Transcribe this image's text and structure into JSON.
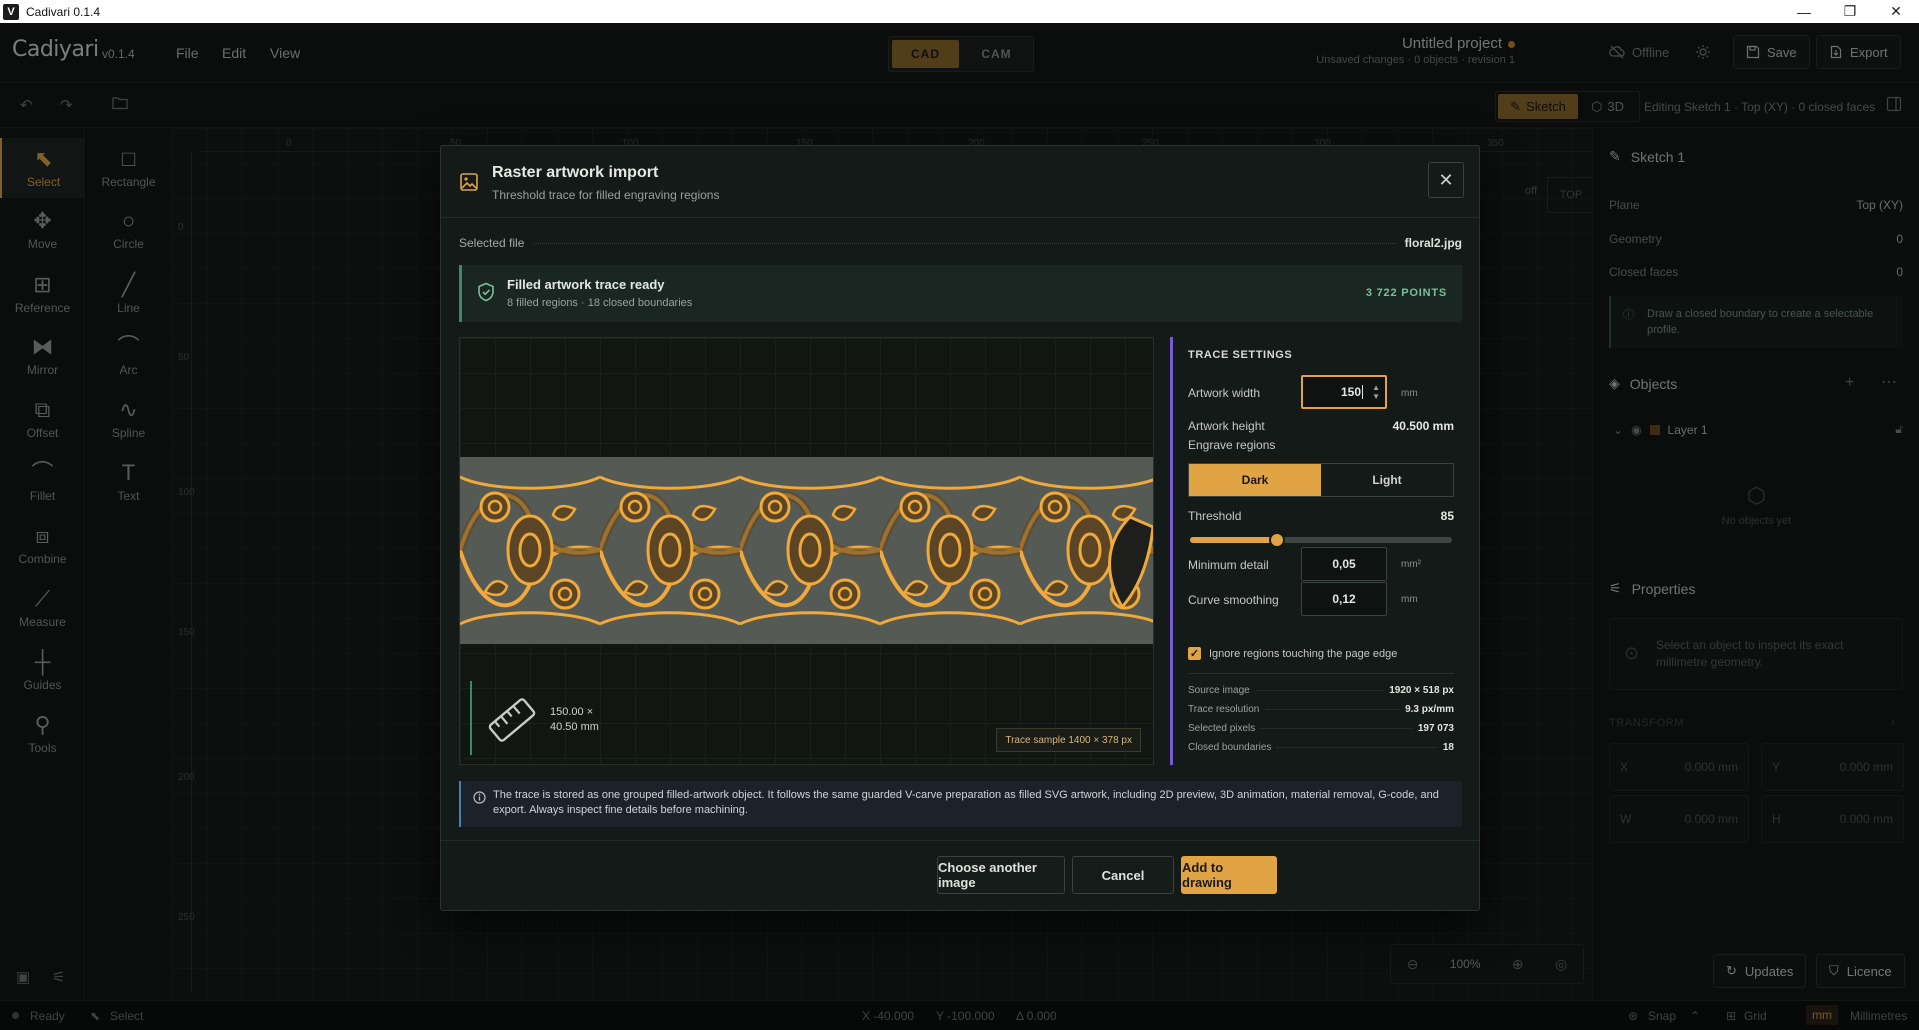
{
  "window": {
    "title": "Cadivari 0.1.4",
    "logo": "V",
    "controls": [
      "—",
      "❐",
      "✕"
    ]
  },
  "menubar": {
    "brand": "Cadiyari",
    "version": "v0.1.4",
    "menus": [
      "File",
      "Edit",
      "View"
    ],
    "modes": [
      "CAD",
      "CAM"
    ],
    "project_name": "Untitled project",
    "project_status": "Unsaved changes · 0 objects · revision 1",
    "offline_label": "Offline",
    "save_label": "Save",
    "export_label": "Export"
  },
  "toolrow": {
    "view_sketch": "Sketch",
    "view_3d": "3D",
    "editing_text": "Editing Sketch 1 · Top (XY) · 0 closed faces"
  },
  "tools_left": [
    "Select",
    "Move",
    "Reference",
    "Mirror",
    "Offset",
    "Fillet",
    "Combine",
    "Measure",
    "Guides",
    "Tools"
  ],
  "tools_right": [
    "Rectangle",
    "Circle",
    "Line",
    "Arc",
    "Spline",
    "Text"
  ],
  "rulers": {
    "x": [
      "0",
      "50",
      "100",
      "150",
      "200",
      "250",
      "300",
      "350"
    ],
    "y": [
      "0",
      "50",
      "100",
      "150",
      "200",
      "250"
    ]
  },
  "viewcube": {
    "label": "TOP",
    "off_label": "off"
  },
  "zoom": {
    "level": "100%"
  },
  "panel": {
    "sketch_title": "Sketch 1",
    "rows": [
      {
        "label": "Plane",
        "value": "Top (XY)"
      },
      {
        "label": "Geometry",
        "value": "0"
      },
      {
        "label": "Closed faces",
        "value": "0"
      }
    ],
    "sketch_note": "Draw a closed boundary to create a selectable profile.",
    "objects_title": "Objects",
    "layer_name": "Layer 1",
    "no_objects": "No objects yet",
    "properties_title": "Properties",
    "properties_note": "Select an object to inspect its exact millimetre geometry.",
    "transform_title": "TRANSFORM",
    "fields": [
      {
        "label": "X",
        "value": "0.000",
        "unit": "mm"
      },
      {
        "label": "Y",
        "value": "0.000",
        "unit": "mm"
      },
      {
        "label": "W",
        "value": "0.000",
        "unit": "mm"
      },
      {
        "label": "H",
        "value": "0.000",
        "unit": "mm"
      }
    ],
    "updates_label": "Updates",
    "licence_label": "Licence"
  },
  "statusbar": {
    "ready": "Ready",
    "tool": "Select",
    "x": "X  -40.000",
    "y": "Y  -100.000",
    "delta": "Δ  0.000",
    "snap": "Snap",
    "grid": "Grid",
    "unit": "mm",
    "unit_name": "Millimetres"
  },
  "modal": {
    "title": "Raster artwork import",
    "subtitle": "Threshold trace for filled engraving regions",
    "selected_file_label": "Selected file",
    "selected_file": "floral2.jpg",
    "banner_title": "Filled artwork trace ready",
    "banner_sub": "8 filled regions · 18 closed boundaries",
    "banner_points": "3 722 POINTS",
    "dims_text_1": "150.00 ×",
    "dims_text_2": "40.50 mm",
    "trace_sample": "Trace sample 1400 × 378 px",
    "settings": {
      "heading": "TRACE SETTINGS",
      "width_label": "Artwork width",
      "width_value": "150",
      "width_unit": "mm",
      "height_label": "Artwork height",
      "height_value": "40.500 mm",
      "engrave_label": "Engrave regions",
      "engrave_options": [
        "Dark",
        "Light"
      ],
      "engrave_selected": "Dark",
      "threshold_label": "Threshold",
      "threshold_value": "85",
      "threshold_fraction": 0.333,
      "min_detail_label": "Minimum detail",
      "min_detail_value": "0,05",
      "min_detail_unit": "mm²",
      "smoothing_label": "Curve smoothing",
      "smoothing_value": "0,12",
      "smoothing_unit": "mm",
      "ignore_edge_label": "Ignore regions touching the page edge",
      "ignore_edge_checked": true
    },
    "stats": [
      {
        "label": "Source image",
        "value": "1920 × 518 px"
      },
      {
        "label": "Trace resolution",
        "value": "9.3 px/mm"
      },
      {
        "label": "Selected pixels",
        "value": "197 073"
      },
      {
        "label": "Closed boundaries",
        "value": "18"
      }
    ],
    "info": "The trace is stored as one grouped filled-artwork object. It follows the same guarded V-carve preparation as filled SVG artwork, including 2D preview, 3D animation, material removal, G-code, and export. Always inspect fine details before machining.",
    "buttons": {
      "choose": "Choose another image",
      "cancel": "Cancel",
      "add": "Add to drawing"
    }
  },
  "colors": {
    "accent": "#e0a444",
    "success": "#3b8a66",
    "info": "#4b7fb5",
    "settings_accent": "#7b5bd1",
    "background": "#0f1311"
  }
}
